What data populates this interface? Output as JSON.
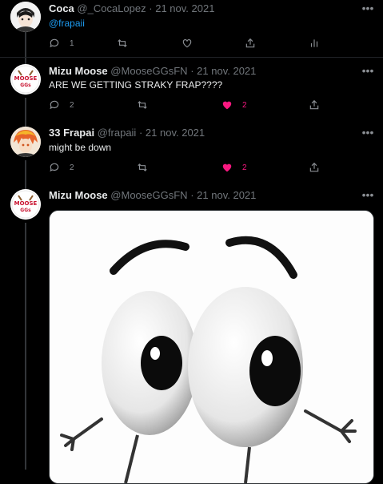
{
  "tweets": [
    {
      "name": "Coca",
      "handle": "@_CocaLopez",
      "sep": "·",
      "date": "21 nov. 2021",
      "text": "@frapaii",
      "replies": "1",
      "retweets": "",
      "likes": ""
    },
    {
      "name": "Mizu Moose",
      "handle": "@MooseGGsFN",
      "sep": "·",
      "date": "21 nov. 2021",
      "text": "ARE WE GETTING STRAKY FRAP????",
      "replies": "2",
      "retweets": "",
      "likes": "2",
      "avatar_text": "MOOSE",
      "avatar_sub": "GGs"
    },
    {
      "name": "33 Frapai",
      "handle": "@frapaii",
      "sep": "·",
      "date": "21 nov. 2021",
      "text": "might be down",
      "replies": "2",
      "retweets": "",
      "likes": "2"
    },
    {
      "name": "Mizu Moose",
      "handle": "@MooseGGsFN",
      "sep": "·",
      "date": "21 nov. 2021",
      "avatar_text": "MOOSE",
      "avatar_sub": "GGs"
    }
  ],
  "more_icon": "more-dots-icon",
  "colors": {
    "background": "#000000",
    "like_active": "#f91880",
    "link": "#1d9bf0",
    "muted": "#71767b"
  }
}
